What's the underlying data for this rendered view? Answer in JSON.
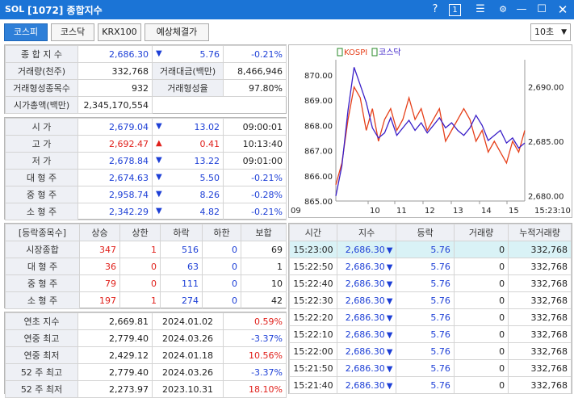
{
  "titlebar": {
    "logo": "SOL",
    "title": "[1072] 종합지수",
    "help": "?",
    "num": "1"
  },
  "tabs": [
    {
      "label": "코스피",
      "active": true
    },
    {
      "label": "코스닥",
      "active": false
    },
    {
      "label": "KRX100",
      "active": false
    },
    {
      "label": "예상체결가",
      "active": false
    }
  ],
  "interval": "10초",
  "summary": {
    "r1": {
      "l": "종 합 지 수",
      "v": "2,686.30",
      "chg": "5.76",
      "pct": "-0.21%"
    },
    "r2": {
      "l1": "거래량(천주)",
      "v1": "332,768",
      "l2": "거래대금(백만)",
      "v2": "8,466,946"
    },
    "r3": {
      "l1": "거래형성종목수",
      "v1": "932",
      "l2": "거래형성율",
      "v2": "97.80%"
    },
    "r4": {
      "l": "시가총액(백만)",
      "v": "2,345,170,554"
    }
  },
  "prices": [
    {
      "l": "시 가",
      "v": "2,679.04",
      "dir": "down",
      "chg": "13.02",
      "t": "09:00:01",
      "vc": "blue"
    },
    {
      "l": "고 가",
      "v": "2,692.47",
      "dir": "up",
      "chg": "0.41",
      "t": "10:13:40",
      "vc": "red"
    },
    {
      "l": "저 가",
      "v": "2,678.84",
      "dir": "down",
      "chg": "13.22",
      "t": "09:01:00",
      "vc": "blue"
    },
    {
      "l": "대 형 주",
      "v": "2,674.63",
      "dir": "down",
      "chg": "5.50",
      "t": "-0.21%",
      "vc": "blue"
    },
    {
      "l": "중 형 주",
      "v": "2,958.74",
      "dir": "down",
      "chg": "8.26",
      "t": "-0.28%",
      "vc": "blue"
    },
    {
      "l": "소 형 주",
      "v": "2,342.29",
      "dir": "down",
      "chg": "4.82",
      "t": "-0.21%",
      "vc": "blue"
    }
  ],
  "breadth": {
    "headers": [
      "[등락종목수]",
      "상승",
      "상한",
      "하락",
      "하한",
      "보합"
    ],
    "rows": [
      [
        "시장종합",
        "347",
        "1",
        "516",
        "0",
        "69"
      ],
      [
        "대 형 주",
        "36",
        "0",
        "63",
        "0",
        "1"
      ],
      [
        "중 형 주",
        "79",
        "0",
        "111",
        "0",
        "10"
      ],
      [
        "소 형 주",
        "197",
        "1",
        "274",
        "0",
        "42"
      ]
    ]
  },
  "yearly": [
    {
      "l": "연초  지수",
      "v": "2,669.81",
      "d": "2024.01.02",
      "p": "0.59%",
      "pc": "red"
    },
    {
      "l": "연중  최고",
      "v": "2,779.40",
      "d": "2024.03.26",
      "p": "-3.37%",
      "pc": "blue"
    },
    {
      "l": "연중  최저",
      "v": "2,429.12",
      "d": "2024.01.18",
      "p": "10.56%",
      "pc": "red"
    },
    {
      "l": "52 주 최고",
      "v": "2,779.40",
      "d": "2024.03.26",
      "p": "-3.37%",
      "pc": "blue"
    },
    {
      "l": "52 주 최저",
      "v": "2,273.97",
      "d": "2023.10.31",
      "p": "18.10%",
      "pc": "red"
    }
  ],
  "ticks": {
    "headers": [
      "시간",
      "지수",
      "등락",
      "거래량",
      "누적거래량"
    ],
    "rows": [
      [
        "15:23:00",
        "2,686.30",
        "5.76",
        "0",
        "332,768"
      ],
      [
        "15:22:50",
        "2,686.30",
        "5.76",
        "0",
        "332,768"
      ],
      [
        "15:22:40",
        "2,686.30",
        "5.76",
        "0",
        "332,768"
      ],
      [
        "15:22:30",
        "2,686.30",
        "5.76",
        "0",
        "332,768"
      ],
      [
        "15:22:20",
        "2,686.30",
        "5.76",
        "0",
        "332,768"
      ],
      [
        "15:22:10",
        "2,686.30",
        "5.76",
        "0",
        "332,768"
      ],
      [
        "15:22:00",
        "2,686.30",
        "5.76",
        "0",
        "332,768"
      ],
      [
        "15:21:50",
        "2,686.30",
        "5.76",
        "0",
        "332,768"
      ],
      [
        "15:21:40",
        "2,686.30",
        "5.76",
        "0",
        "332,768"
      ]
    ]
  },
  "chart_data": {
    "type": "line",
    "legend": [
      "KOSPI",
      "코스닥"
    ],
    "x_ticks": [
      "09",
      "10",
      "11",
      "12",
      "13",
      "14",
      "15"
    ],
    "time_label": "15:23:10",
    "left_ticks": [
      "870.00",
      "869.00",
      "868.00",
      "867.00",
      "866.00",
      "865.00"
    ],
    "right_ticks": [
      "2,690.00",
      "2,685.00",
      "2,680.00"
    ],
    "left_ylim": [
      865,
      870.6
    ],
    "right_ylim": [
      2679.5,
      2692.5
    ],
    "series": [
      {
        "name": "KOSPI",
        "axis": "right",
        "color": "#e6401a",
        "values": [
          2681,
          2683,
          2687,
          2690,
          2689,
          2686,
          2688,
          2685,
          2687,
          2688,
          2686,
          2687,
          2689,
          2687,
          2688,
          2686,
          2687,
          2688,
          2685,
          2686,
          2687,
          2688,
          2687,
          2685,
          2686,
          2684,
          2685,
          2684,
          2683,
          2685,
          2684,
          2686
        ]
      },
      {
        "name": "코스닥",
        "axis": "left",
        "color": "#3a1fc8",
        "values": [
          865.2,
          866.4,
          868.6,
          870.3,
          869.6,
          868.9,
          867.9,
          867.5,
          867.7,
          868.3,
          867.6,
          867.9,
          868.2,
          867.8,
          868.1,
          867.7,
          868.0,
          868.3,
          867.9,
          868.1,
          867.8,
          867.6,
          867.9,
          868.4,
          868.0,
          867.4,
          867.6,
          867.8,
          867.3,
          867.5,
          867.1,
          867.3
        ]
      }
    ]
  },
  "colors": {
    "title_bar": "#1b74d6",
    "up": "#e0201b",
    "down": "#1d3fd6",
    "label_bg": "#eef0f5",
    "selected_row": "#d9f2f6"
  }
}
